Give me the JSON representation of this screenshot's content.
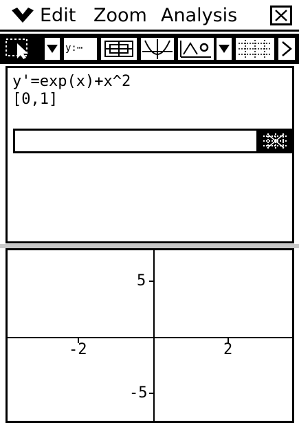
{
  "menu": {
    "edit_label": "Edit",
    "zoom_label": "Zoom",
    "analysis_label": "Analysis"
  },
  "toolbar": {
    "buttons": [
      "select-pointer",
      "y-equals-list",
      "zoom-box",
      "graph-sketch",
      "analysis-tool",
      "grid-toggle"
    ],
    "y_list_label": "y:⋯"
  },
  "editor": {
    "line1": "y'=exp(x)+x^2",
    "line2": "[0,1]",
    "entry_value": ""
  },
  "graph": {
    "y_tick_top": "5",
    "y_tick_bottom": "-5",
    "x_tick_left": "-2",
    "x_tick_right": "2"
  },
  "colors": {
    "background": "#ffffff",
    "foreground": "#000000",
    "divider": "#c9c9c9"
  }
}
